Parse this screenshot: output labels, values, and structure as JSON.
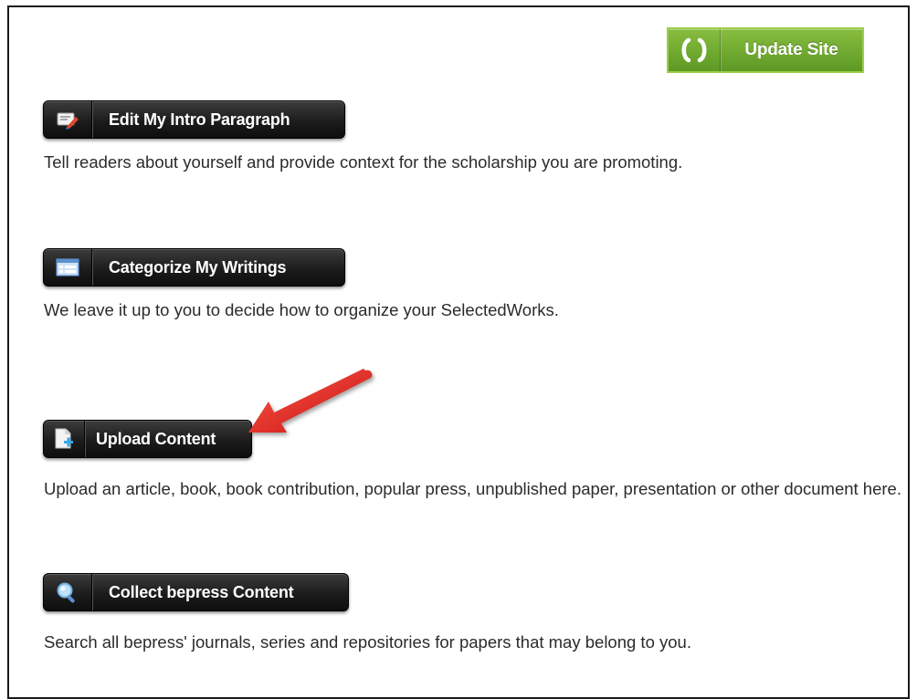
{
  "update": {
    "label": "Update Site",
    "icon": "refresh-icon",
    "color": "#6fa82f"
  },
  "sections": [
    {
      "button_label": "Edit My Intro Paragraph",
      "icon": "edit-pencil-icon",
      "description": "Tell readers about yourself and provide context for the scholarship you are promoting."
    },
    {
      "button_label": "Categorize My Writings",
      "icon": "list-icon",
      "description": "We leave it up to you to decide how to organize your SelectedWorks."
    },
    {
      "button_label": "Upload Content",
      "icon": "upload-document-icon",
      "description": "Upload an article, book, book contribution, popular press, unpublished paper, presentation or other document here."
    },
    {
      "button_label": "Collect bepress Content",
      "icon": "magnifier-icon",
      "description": "Search all bepress' journals, series and repositories for papers that may belong to you."
    }
  ],
  "annotation": {
    "icon": "red-arrow-icon",
    "color": "#d81818"
  }
}
